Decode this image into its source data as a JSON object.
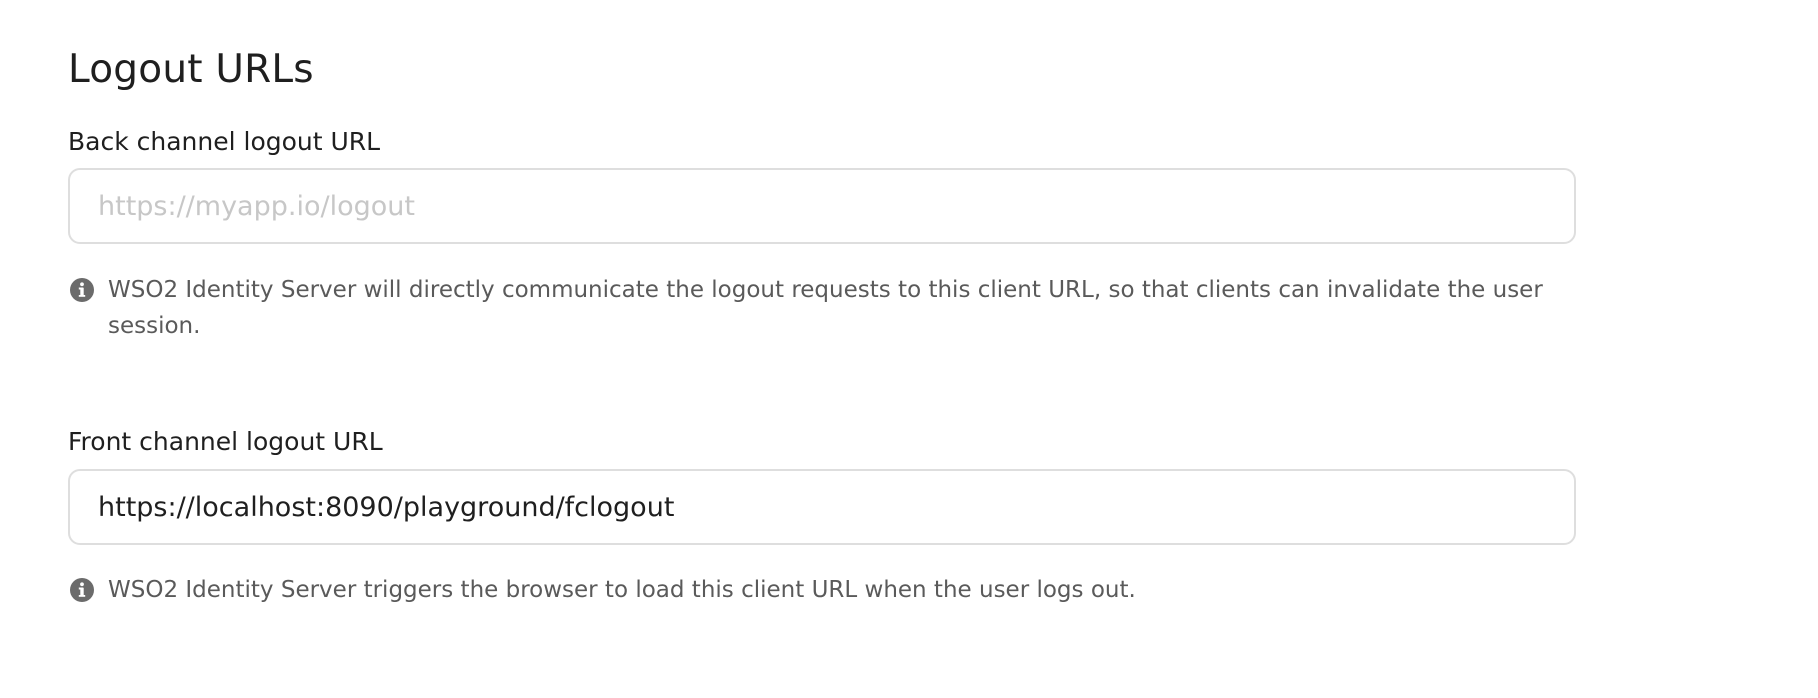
{
  "section": {
    "title": "Logout URLs"
  },
  "back_channel": {
    "label": "Back channel logout URL",
    "value": "",
    "placeholder": "https://myapp.io/logout",
    "hint_icon": "info-icon",
    "hint": "WSO2 Identity Server will directly communicate the logout requests to this client URL, so that clients can invalidate the user session."
  },
  "front_channel": {
    "label": "Front channel logout URL",
    "value": "https://localhost:8090/playground/fclogout",
    "placeholder": "",
    "hint_icon": "info-icon",
    "hint": "WSO2 Identity Server triggers the browser to load this client URL when the user logs out."
  },
  "colors": {
    "hint_icon": "#6b6b6b",
    "input_border": "#dedede",
    "placeholder": "#c7c7c7"
  }
}
